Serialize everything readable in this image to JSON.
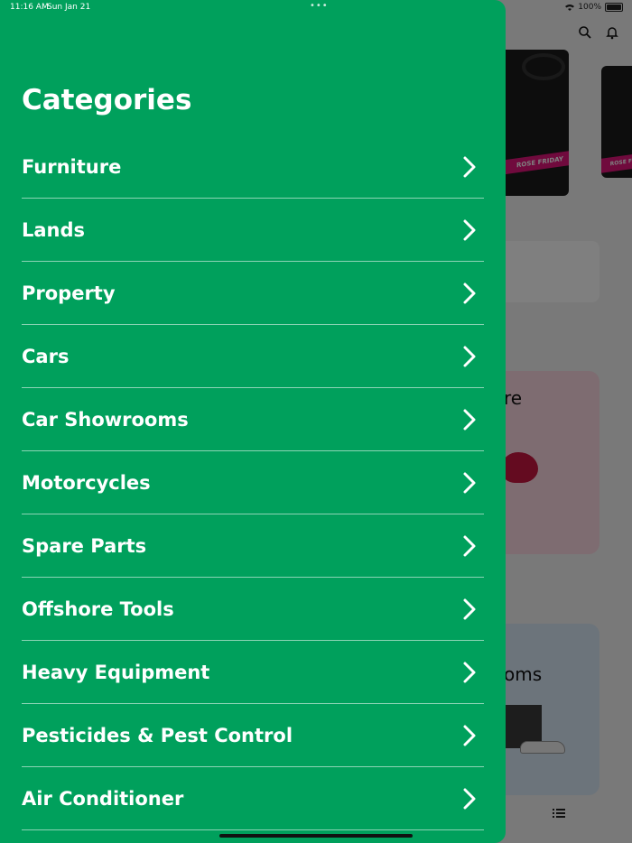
{
  "status_bar": {
    "time": "11:16 AM",
    "date": "Sun Jan 21",
    "multitask_dots": "•••",
    "battery": "100%"
  },
  "background": {
    "banner_ribbon_text": "ROSE FRIDAY",
    "banner2_ribbon_text": "ROSE F",
    "pink_card_fragment": "re",
    "blue_card_fragment": "oms"
  },
  "drawer": {
    "title": "Categories",
    "accent_color": "#00a05c",
    "items": [
      {
        "label": "Furniture"
      },
      {
        "label": "Lands"
      },
      {
        "label": "Property"
      },
      {
        "label": "Cars"
      },
      {
        "label": "Car Showrooms"
      },
      {
        "label": "Motorcycles"
      },
      {
        "label": "Spare Parts"
      },
      {
        "label": "Offshore Tools"
      },
      {
        "label": "Heavy Equipment"
      },
      {
        "label": "Pesticides & Pest Control"
      },
      {
        "label": "Air Conditioner"
      }
    ]
  },
  "icons": {
    "search": "search-icon",
    "notifications": "bell-icon",
    "chevron": "chevron-right-icon",
    "list": "list-icon"
  }
}
